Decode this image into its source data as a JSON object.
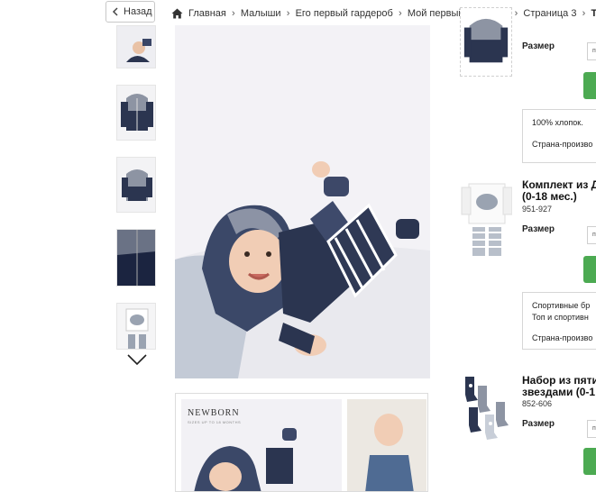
{
  "nav": {
    "back_label": "Назад",
    "breadcrumbs": [
      "Главная",
      "Малыши",
      "Его первый гардероб",
      "Мой первый гардероб",
      "Страница 3",
      "Те"
    ]
  },
  "gallery": {
    "lookbook_title": "NEWBORN",
    "lookbook_subtitle": "SIZES UP TO 18 MONTHS"
  },
  "products": [
    {
      "code": "",
      "size_label": "Размер",
      "select_value": "п",
      "description": [
        "100% хлопок.",
        "Страна-произво"
      ]
    },
    {
      "title_line1": "Комплект из Д",
      "title_line2": "(0-18 мес.)",
      "code": "951-927",
      "size_label": "Размер",
      "select_value": "п",
      "description": [
        "Спортивные бр",
        "Топ и спортивн",
        "Страна-произво"
      ]
    },
    {
      "title_line1": "Набор из пяти",
      "title_line2": "звездами (0-1",
      "code": "852-606",
      "size_label": "Размер",
      "select_value": "п"
    }
  ],
  "colors": {
    "accent_green": "#4caa52",
    "navy": "#2b3550"
  },
  "icons": [
    "chevron-left-icon",
    "home-icon",
    "chevron-right-icon",
    "chevron-down-icon"
  ]
}
